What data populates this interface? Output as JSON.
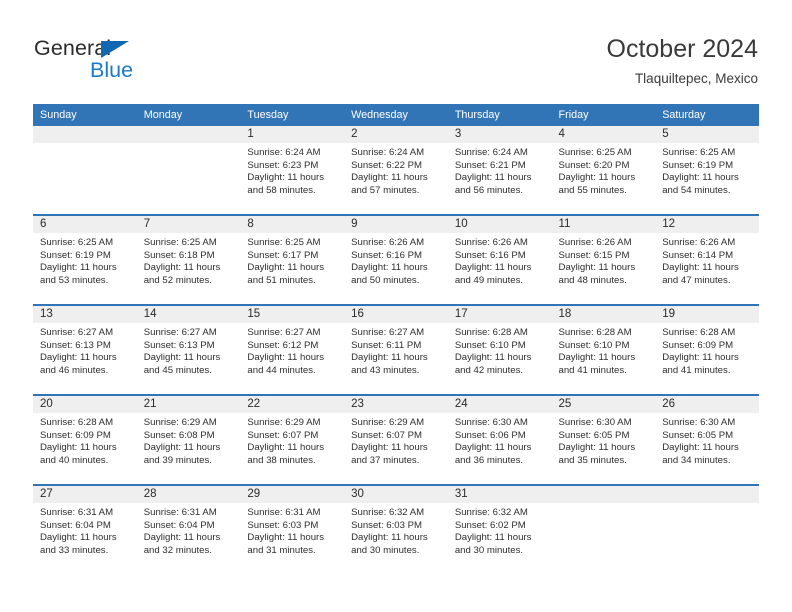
{
  "brand": {
    "name_top": "General",
    "name_bottom": "Blue",
    "triangle_color": "#1267b3",
    "blue_color": "#1b79c9"
  },
  "header": {
    "month_title": "October 2024",
    "location": "Tlaquiltepec, Mexico"
  },
  "theme": {
    "header_blue": "#3275b7",
    "daynum_band": "#efefef",
    "cell_background": "#ffffff",
    "text": "#2e2e2e"
  },
  "weekdays": [
    "Sunday",
    "Monday",
    "Tuesday",
    "Wednesday",
    "Thursday",
    "Friday",
    "Saturday"
  ],
  "weeks": [
    [
      {
        "day": "",
        "lines": []
      },
      {
        "day": "",
        "lines": []
      },
      {
        "day": "1",
        "lines": [
          "Sunrise: 6:24 AM",
          "Sunset: 6:23 PM",
          "Daylight: 11 hours",
          "and 58 minutes."
        ]
      },
      {
        "day": "2",
        "lines": [
          "Sunrise: 6:24 AM",
          "Sunset: 6:22 PM",
          "Daylight: 11 hours",
          "and 57 minutes."
        ]
      },
      {
        "day": "3",
        "lines": [
          "Sunrise: 6:24 AM",
          "Sunset: 6:21 PM",
          "Daylight: 11 hours",
          "and 56 minutes."
        ]
      },
      {
        "day": "4",
        "lines": [
          "Sunrise: 6:25 AM",
          "Sunset: 6:20 PM",
          "Daylight: 11 hours",
          "and 55 minutes."
        ]
      },
      {
        "day": "5",
        "lines": [
          "Sunrise: 6:25 AM",
          "Sunset: 6:19 PM",
          "Daylight: 11 hours",
          "and 54 minutes."
        ]
      }
    ],
    [
      {
        "day": "6",
        "lines": [
          "Sunrise: 6:25 AM",
          "Sunset: 6:19 PM",
          "Daylight: 11 hours",
          "and 53 minutes."
        ]
      },
      {
        "day": "7",
        "lines": [
          "Sunrise: 6:25 AM",
          "Sunset: 6:18 PM",
          "Daylight: 11 hours",
          "and 52 minutes."
        ]
      },
      {
        "day": "8",
        "lines": [
          "Sunrise: 6:25 AM",
          "Sunset: 6:17 PM",
          "Daylight: 11 hours",
          "and 51 minutes."
        ]
      },
      {
        "day": "9",
        "lines": [
          "Sunrise: 6:26 AM",
          "Sunset: 6:16 PM",
          "Daylight: 11 hours",
          "and 50 minutes."
        ]
      },
      {
        "day": "10",
        "lines": [
          "Sunrise: 6:26 AM",
          "Sunset: 6:16 PM",
          "Daylight: 11 hours",
          "and 49 minutes."
        ]
      },
      {
        "day": "11",
        "lines": [
          "Sunrise: 6:26 AM",
          "Sunset: 6:15 PM",
          "Daylight: 11 hours",
          "and 48 minutes."
        ]
      },
      {
        "day": "12",
        "lines": [
          "Sunrise: 6:26 AM",
          "Sunset: 6:14 PM",
          "Daylight: 11 hours",
          "and 47 minutes."
        ]
      }
    ],
    [
      {
        "day": "13",
        "lines": [
          "Sunrise: 6:27 AM",
          "Sunset: 6:13 PM",
          "Daylight: 11 hours",
          "and 46 minutes."
        ]
      },
      {
        "day": "14",
        "lines": [
          "Sunrise: 6:27 AM",
          "Sunset: 6:13 PM",
          "Daylight: 11 hours",
          "and 45 minutes."
        ]
      },
      {
        "day": "15",
        "lines": [
          "Sunrise: 6:27 AM",
          "Sunset: 6:12 PM",
          "Daylight: 11 hours",
          "and 44 minutes."
        ]
      },
      {
        "day": "16",
        "lines": [
          "Sunrise: 6:27 AM",
          "Sunset: 6:11 PM",
          "Daylight: 11 hours",
          "and 43 minutes."
        ]
      },
      {
        "day": "17",
        "lines": [
          "Sunrise: 6:28 AM",
          "Sunset: 6:10 PM",
          "Daylight: 11 hours",
          "and 42 minutes."
        ]
      },
      {
        "day": "18",
        "lines": [
          "Sunrise: 6:28 AM",
          "Sunset: 6:10 PM",
          "Daylight: 11 hours",
          "and 41 minutes."
        ]
      },
      {
        "day": "19",
        "lines": [
          "Sunrise: 6:28 AM",
          "Sunset: 6:09 PM",
          "Daylight: 11 hours",
          "and 41 minutes."
        ]
      }
    ],
    [
      {
        "day": "20",
        "lines": [
          "Sunrise: 6:28 AM",
          "Sunset: 6:09 PM",
          "Daylight: 11 hours",
          "and 40 minutes."
        ]
      },
      {
        "day": "21",
        "lines": [
          "Sunrise: 6:29 AM",
          "Sunset: 6:08 PM",
          "Daylight: 11 hours",
          "and 39 minutes."
        ]
      },
      {
        "day": "22",
        "lines": [
          "Sunrise: 6:29 AM",
          "Sunset: 6:07 PM",
          "Daylight: 11 hours",
          "and 38 minutes."
        ]
      },
      {
        "day": "23",
        "lines": [
          "Sunrise: 6:29 AM",
          "Sunset: 6:07 PM",
          "Daylight: 11 hours",
          "and 37 minutes."
        ]
      },
      {
        "day": "24",
        "lines": [
          "Sunrise: 6:30 AM",
          "Sunset: 6:06 PM",
          "Daylight: 11 hours",
          "and 36 minutes."
        ]
      },
      {
        "day": "25",
        "lines": [
          "Sunrise: 6:30 AM",
          "Sunset: 6:05 PM",
          "Daylight: 11 hours",
          "and 35 minutes."
        ]
      },
      {
        "day": "26",
        "lines": [
          "Sunrise: 6:30 AM",
          "Sunset: 6:05 PM",
          "Daylight: 11 hours",
          "and 34 minutes."
        ]
      }
    ],
    [
      {
        "day": "27",
        "lines": [
          "Sunrise: 6:31 AM",
          "Sunset: 6:04 PM",
          "Daylight: 11 hours",
          "and 33 minutes."
        ]
      },
      {
        "day": "28",
        "lines": [
          "Sunrise: 6:31 AM",
          "Sunset: 6:04 PM",
          "Daylight: 11 hours",
          "and 32 minutes."
        ]
      },
      {
        "day": "29",
        "lines": [
          "Sunrise: 6:31 AM",
          "Sunset: 6:03 PM",
          "Daylight: 11 hours",
          "and 31 minutes."
        ]
      },
      {
        "day": "30",
        "lines": [
          "Sunrise: 6:32 AM",
          "Sunset: 6:03 PM",
          "Daylight: 11 hours",
          "and 30 minutes."
        ]
      },
      {
        "day": "31",
        "lines": [
          "Sunrise: 6:32 AM",
          "Sunset: 6:02 PM",
          "Daylight: 11 hours",
          "and 30 minutes."
        ]
      },
      {
        "day": "",
        "lines": []
      },
      {
        "day": "",
        "lines": []
      }
    ]
  ]
}
